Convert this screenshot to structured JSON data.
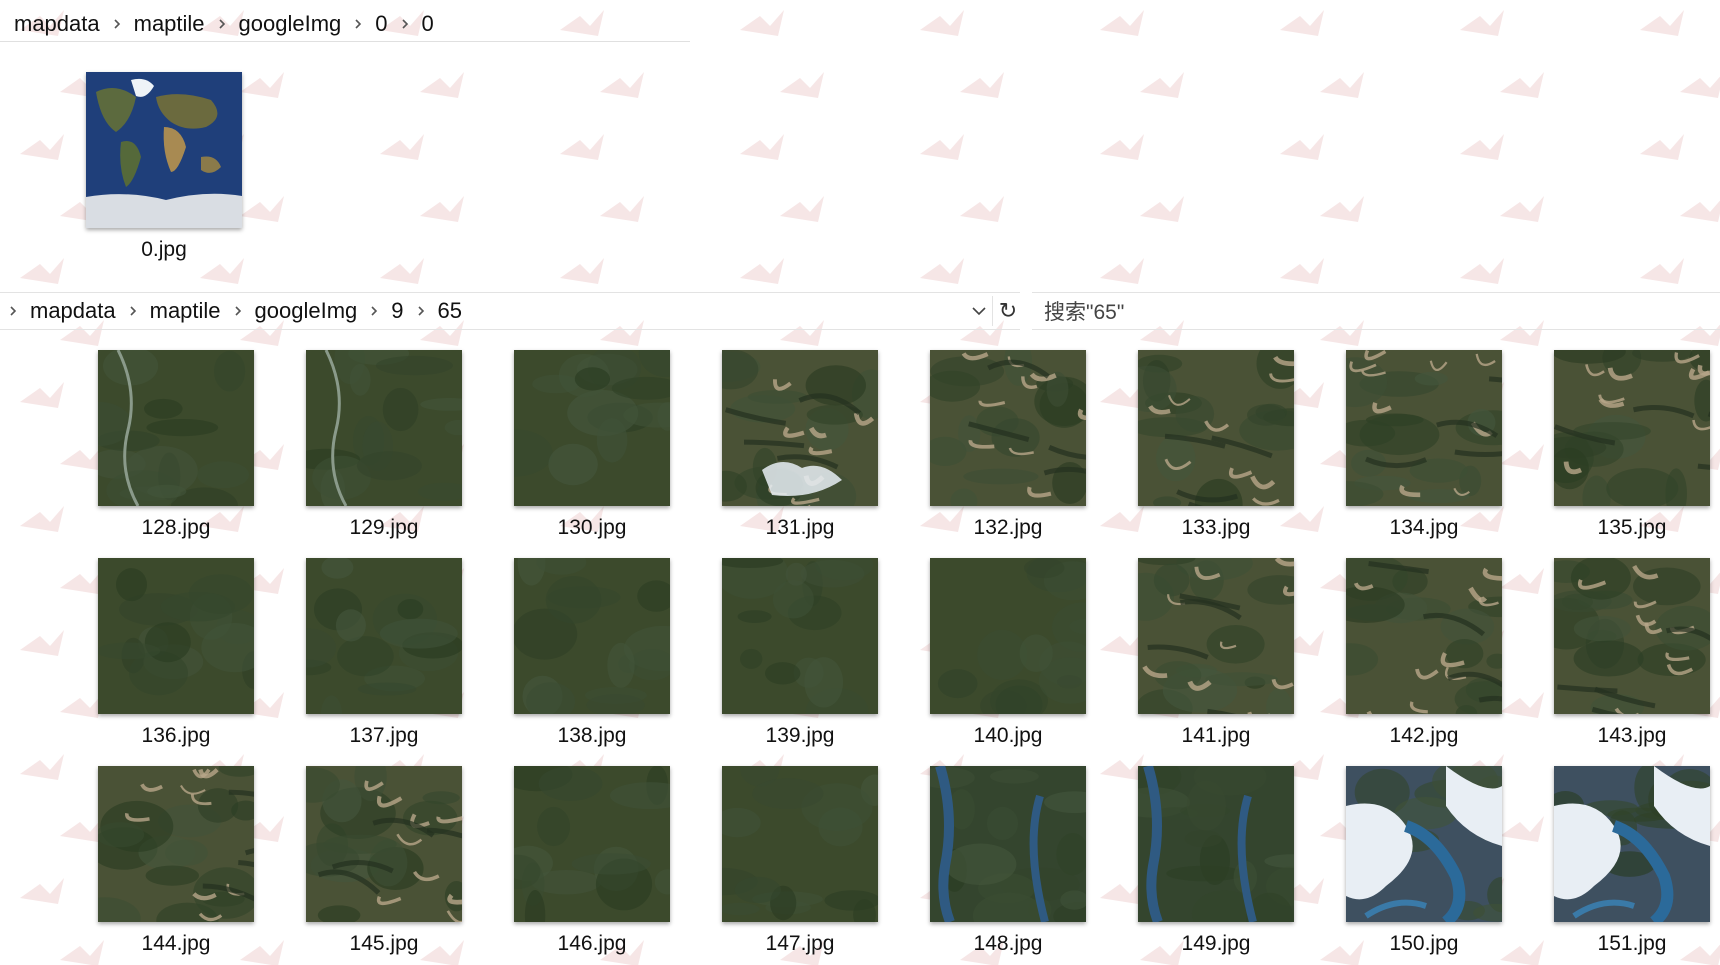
{
  "breadcrumb_top": [
    "mapdata",
    "maptile",
    "googleImg",
    "0",
    "0"
  ],
  "top_file": {
    "name": "0.jpg",
    "tile": "world"
  },
  "breadcrumb_bottom": [
    "mapdata",
    "maptile",
    "googleImg",
    "9",
    "65"
  ],
  "search": {
    "placeholder": "搜索\"65\""
  },
  "icons": {
    "chevron": "chevron-right-icon",
    "dropdown": "chevron-down-icon",
    "refresh": "refresh-icon"
  },
  "files": [
    {
      "name": "128.jpg",
      "tile": "forest-river"
    },
    {
      "name": "129.jpg",
      "tile": "forest-river"
    },
    {
      "name": "130.jpg",
      "tile": "forest"
    },
    {
      "name": "131.jpg",
      "tile": "mountain-snow"
    },
    {
      "name": "132.jpg",
      "tile": "mountain"
    },
    {
      "name": "133.jpg",
      "tile": "mountain"
    },
    {
      "name": "134.jpg",
      "tile": "mountain"
    },
    {
      "name": "135.jpg",
      "tile": "mountain"
    },
    {
      "name": "136.jpg",
      "tile": "forest"
    },
    {
      "name": "137.jpg",
      "tile": "forest"
    },
    {
      "name": "138.jpg",
      "tile": "forest"
    },
    {
      "name": "139.jpg",
      "tile": "forest"
    },
    {
      "name": "140.jpg",
      "tile": "forest"
    },
    {
      "name": "141.jpg",
      "tile": "mountain"
    },
    {
      "name": "142.jpg",
      "tile": "mountain"
    },
    {
      "name": "143.jpg",
      "tile": "mountain"
    },
    {
      "name": "144.jpg",
      "tile": "mountain"
    },
    {
      "name": "145.jpg",
      "tile": "mountain"
    },
    {
      "name": "146.jpg",
      "tile": "forest"
    },
    {
      "name": "147.jpg",
      "tile": "forest"
    },
    {
      "name": "148.jpg",
      "tile": "lake"
    },
    {
      "name": "149.jpg",
      "tile": "lake"
    },
    {
      "name": "150.jpg",
      "tile": "glacier"
    },
    {
      "name": "151.jpg",
      "tile": "glacier"
    }
  ],
  "colors": {
    "forest": "#3c4a2c",
    "mountain": "#4a5236",
    "water": "#2f5a82",
    "snow": "#e8eef4",
    "ocean": "#1f3f7a"
  }
}
